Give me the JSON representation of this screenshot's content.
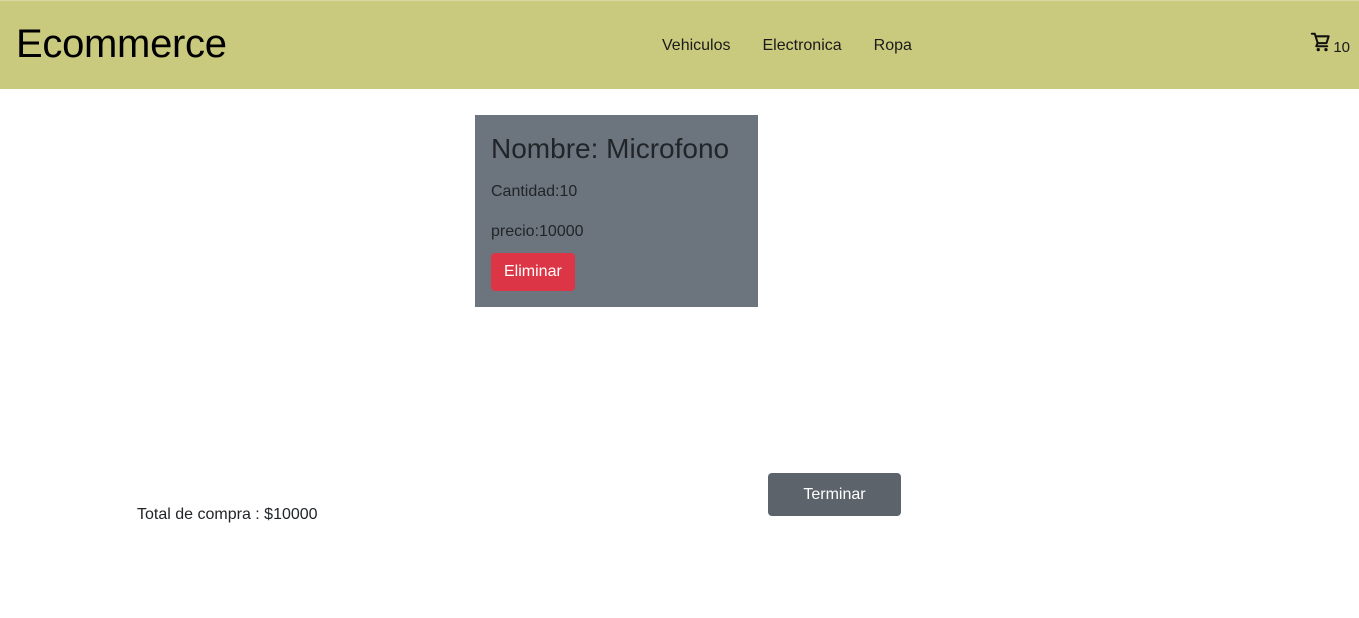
{
  "navbar": {
    "brand": "Ecommerce",
    "links": [
      "Vehiculos",
      "Electronica",
      "Ropa"
    ],
    "cart_icon": "shopping-cart-icon",
    "cart_count": "10",
    "background_color": "#c9ca7e"
  },
  "cart_items": [
    {
      "title": "Nombre: Microfono",
      "quantity_text": "Cantidad:10",
      "price_text": "precio:10000",
      "remove_label": "Eliminar"
    }
  ],
  "summary": {
    "total_text": "Total de compra : $10000",
    "finish_label": "Terminar"
  },
  "colors": {
    "card_background": "#6c757d",
    "danger": "#dc3545",
    "secondary_button": "#5c636a"
  }
}
